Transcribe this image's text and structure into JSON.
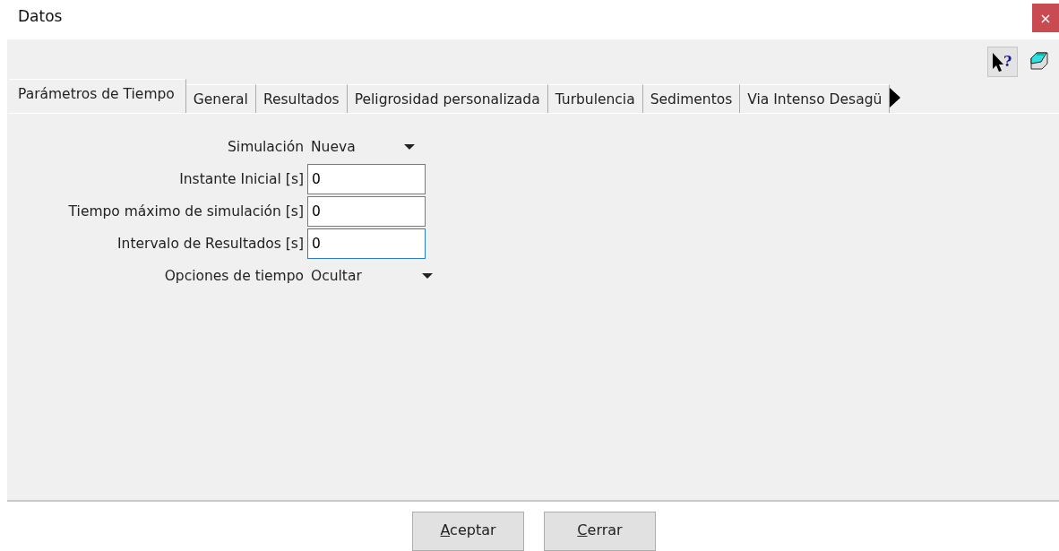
{
  "window": {
    "title": "Datos",
    "close": "×"
  },
  "toolbar": [
    {
      "kind": "help",
      "pressed": true,
      "glyph": "?"
    },
    {
      "kind": "note",
      "pressed": false
    }
  ],
  "tabs": [
    {
      "label": "Parámetros de Tiempo",
      "selected": true
    },
    {
      "label": "General",
      "selected": false
    },
    {
      "label": "Resultados",
      "selected": false
    },
    {
      "label": "Peligrosidad personalizada",
      "selected": false
    },
    {
      "label": "Turbulencia",
      "selected": false
    },
    {
      "label": "Sedimentos",
      "selected": false
    },
    {
      "label": "Via Intenso Desagü",
      "selected": false
    }
  ],
  "form": [
    {
      "kind": "dropdown",
      "label": "Simulación",
      "value": "Nueva"
    },
    {
      "kind": "input",
      "label": "Instante Inicial [s]",
      "value": "0",
      "focused": false
    },
    {
      "kind": "input",
      "label": "Tiempo máximo de simulación [s]",
      "value": "0",
      "focused": false
    },
    {
      "kind": "input",
      "label": "Intervalo de Resultados [s]",
      "value": "0",
      "focused": true
    },
    {
      "kind": "dropdown",
      "label": "Opciones de tiempo",
      "value": "Ocultar"
    }
  ],
  "buttons": [
    {
      "key": "A",
      "rest": "ceptar"
    },
    {
      "key": "C",
      "rest": "errar"
    }
  ]
}
